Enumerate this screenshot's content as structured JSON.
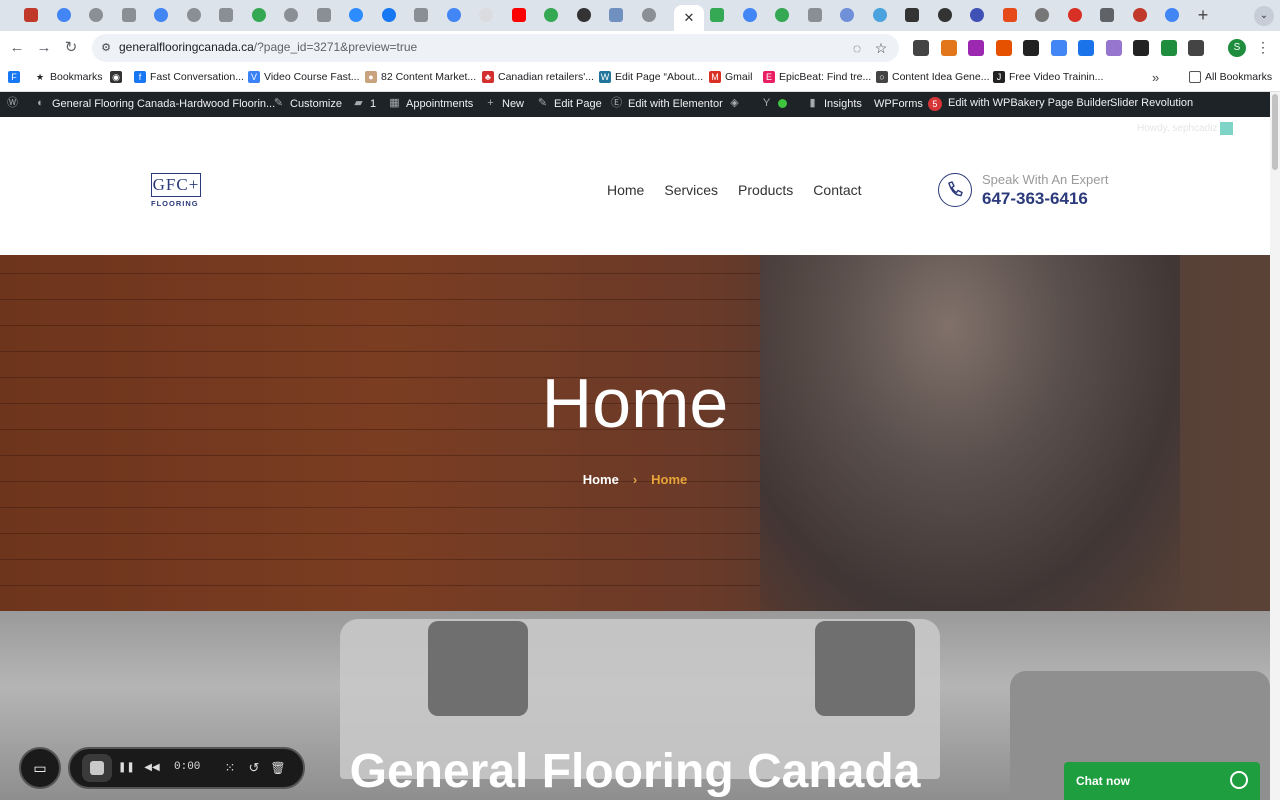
{
  "browser": {
    "tab_count_icons": 37,
    "active_tab_close": "✕",
    "new_tab": "+",
    "tab_menu": "⌄",
    "back": "←",
    "forward": "→",
    "reload": "↻",
    "url_host": "generalflooringcanada.ca",
    "url_path": "/?page_id=3271&preview=true",
    "profile_initial": "S",
    "menu": "⋮",
    "site_info": "⚙",
    "eye_slash": "◌",
    "star": "☆"
  },
  "bookmarks": [
    {
      "label": "",
      "icon": "F"
    },
    {
      "label": "Bookmarks",
      "icon": "★"
    },
    {
      "label": "",
      "icon": "◉"
    },
    {
      "label": "Fast Conversation...",
      "icon": "f"
    },
    {
      "label": "Video Course Fast...",
      "icon": "V"
    },
    {
      "label": "82 Content Market...",
      "icon": "●"
    },
    {
      "label": "Canadian retailers'...",
      "icon": "♣"
    },
    {
      "label": "Edit Page “About...",
      "icon": "W"
    },
    {
      "label": "Gmail",
      "icon": "M"
    },
    {
      "label": "EpicBeat: Find tre...",
      "icon": "E"
    },
    {
      "label": "Content Idea Gene...",
      "icon": "○"
    },
    {
      "label": "Free Video Trainin...",
      "icon": "J"
    }
  ],
  "bookmarks_overflow": "»",
  "all_bookmarks": "All Bookmarks",
  "wp_admin": {
    "site_name": "General Flooring Canada-Hardwood Floorin...",
    "customize": "Customize",
    "comments_count": "1",
    "appointments": "Appointments",
    "new": "New",
    "edit_page": "Edit Page",
    "edit_elementor": "Edit with Elementor",
    "insights": "Insights",
    "wpforms": "WPForms",
    "wpforms_badge": "5",
    "edit_wpbakery": "Edit with WPBakery Page Builder",
    "slider_revolution": "Slider Revolution",
    "howdy": "Howdy, sephcadiz"
  },
  "header": {
    "logo_mark": "GFC+",
    "logo_sub": "FLOORING",
    "nav": [
      "Home",
      "Services",
      "Products",
      "Contact"
    ],
    "speak": "Speak With An Expert",
    "phone": "647-363-6416"
  },
  "hero": {
    "title": "Home",
    "crumb_home": "Home",
    "crumb_sep": "›",
    "crumb_current": "Home"
  },
  "section2": {
    "title": "General Flooring Canada"
  },
  "recorder": {
    "camera_icon": "▭",
    "pause_icon": "❚❚",
    "rewind_icon": "◀◀",
    "time": "0:00",
    "grid_icon": "⁙",
    "restart_icon": "↺",
    "trash_icon": "🗑"
  },
  "chat": {
    "label": "Chat now"
  },
  "colors": {
    "brand_navy": "#2b3a7a",
    "breadcrumb_accent": "#e8a43a",
    "wp_bar": "#1d2327",
    "chat_green": "#1e9e3e"
  }
}
